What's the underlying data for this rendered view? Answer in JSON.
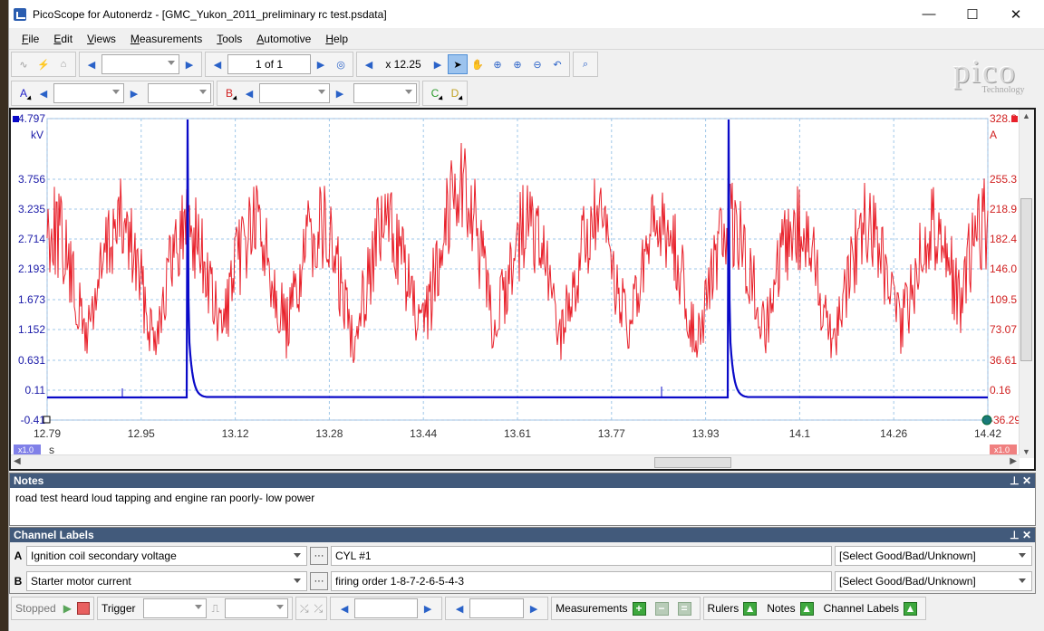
{
  "window": {
    "title": "PicoScope for Autonerdz - [GMC_Yukon_2011_preliminary rc test.psdata]",
    "min_glyph": "—",
    "max_glyph": "☐",
    "close_glyph": "✕"
  },
  "menu": [
    {
      "label": "File",
      "underline": "F",
      "rest": "ile"
    },
    {
      "label": "Edit",
      "underline": "E",
      "rest": "dit"
    },
    {
      "label": "Views",
      "underline": "V",
      "rest": "iews"
    },
    {
      "label": "Measurements",
      "underline": "M",
      "rest": "easurements"
    },
    {
      "label": "Tools",
      "underline": "T",
      "rest": "ools"
    },
    {
      "label": "Automotive",
      "underline": "A",
      "rest": "utomotive"
    },
    {
      "label": "Help",
      "underline": "H",
      "rest": "elp"
    }
  ],
  "toolbar": {
    "buffer": "1 of 1",
    "zoom": "x 12.25"
  },
  "channel_toolbar": {
    "a": "A",
    "b": "B",
    "c": "C",
    "d": "D"
  },
  "logo": {
    "word": "pico",
    "tech": "Technology"
  },
  "scope": {
    "left_axis_unit": "kV",
    "right_axis_unit": "A",
    "left_ticks": [
      "4.797",
      "3.756",
      "3.235",
      "2.714",
      "2.193",
      "1.673",
      "1.152",
      "0.631",
      "0.11",
      "-0.41"
    ],
    "right_ticks": [
      "328.3",
      "255.3",
      "218.9",
      "182.4",
      "146.0",
      "109.5",
      "73.07",
      "36.61",
      "0.16",
      "-36.29"
    ],
    "x_ticks": [
      "12.79",
      "12.95",
      "13.12",
      "13.28",
      "13.44",
      "13.61",
      "13.77",
      "13.93",
      "14.1",
      "14.26",
      "14.42"
    ],
    "x_unit": "s",
    "left_zoom": "x1.0",
    "right_zoom": "x1.0",
    "channel_a_color": "#0a0ac8",
    "channel_b_color": "#e8202a"
  },
  "notes": {
    "header": "Notes",
    "text": "road test heard loud tapping and engine ran poorly- low power"
  },
  "channel_labels": {
    "header": "Channel Labels",
    "rows": [
      {
        "letter": "A",
        "name": "Ignition coil secondary voltage",
        "label": "CYL #1",
        "status": "[Select Good/Bad/Unknown]"
      },
      {
        "letter": "B",
        "name": "Starter motor current",
        "label": "firing order 1-8-7-2-6-5-4-3",
        "status": "[Select Good/Bad/Unknown]"
      }
    ]
  },
  "statusbar": {
    "stopped": "Stopped",
    "trigger": "Trigger",
    "measurements": "Measurements",
    "rulers": "Rulers",
    "notes": "Notes",
    "channel_labels": "Channel Labels"
  }
}
